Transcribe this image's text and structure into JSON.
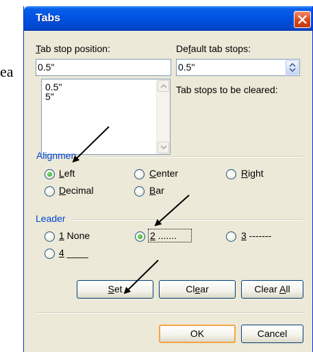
{
  "background": {
    "partial_text": "ea"
  },
  "dialog": {
    "title": "Tabs",
    "tab_stop_position": {
      "label_prefix": "",
      "label_accel": "T",
      "label_rest": "ab stop position:",
      "value": "0.5\""
    },
    "tab_stop_list": [
      "0.5\"",
      "5\""
    ],
    "default_tab_stops": {
      "label_prefix": "De",
      "label_accel": "f",
      "label_rest": "ault tab stops:",
      "value": "0.5\""
    },
    "tab_stops_cleared_label": "Tab stops to be cleared:",
    "alignment": {
      "group_label": "Alignmen",
      "options": [
        {
          "accel": "L",
          "rest": "eft",
          "checked": true
        },
        {
          "accel": "C",
          "rest": "enter",
          "checked": false
        },
        {
          "accel": "R",
          "rest": "ight",
          "checked": false
        },
        {
          "accel": "D",
          "rest": "ecimal",
          "checked": false
        },
        {
          "accel": "B",
          "rest": "ar",
          "checked": false
        }
      ]
    },
    "leader": {
      "group_label": "Leader",
      "options": [
        {
          "accel": "1",
          "rest": " None",
          "checked": false
        },
        {
          "accel": "2",
          "rest": " .......",
          "checked": true
        },
        {
          "accel": "3",
          "rest": " -------",
          "checked": false
        },
        {
          "accel": "4",
          "rest": " ____",
          "checked": false
        }
      ]
    },
    "buttons": {
      "set": {
        "prefix": "",
        "accel": "S",
        "rest": "et"
      },
      "clear": {
        "prefix": "Cl",
        "accel": "e",
        "rest": "ar"
      },
      "clear_all": {
        "prefix": "Clear ",
        "accel": "A",
        "rest": "ll"
      },
      "ok": "OK",
      "cancel": "Cancel"
    }
  },
  "colors": {
    "title_bar": "#0054e3",
    "group_label": "#0046d5",
    "dialog_face": "#ece9d8",
    "close_button": "#d6471a",
    "radio_checked": "#21a121"
  }
}
